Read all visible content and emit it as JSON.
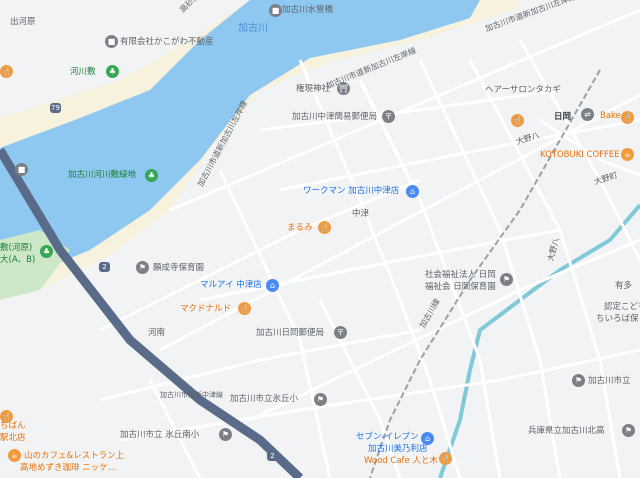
{
  "colors": {
    "background": "#f1f3f4",
    "water": "#8ec7ef",
    "sandbar": "#f7f2dd",
    "highway": "#5a6b89",
    "local_road": "#ffffff",
    "label_grey": "#5f6368",
    "label_food": "#e8710a",
    "label_shop": "#1a73e8",
    "label_park": "#188038",
    "label_water": "#4f8fd9"
  },
  "labels": {
    "dekawara": "出河原",
    "river_name": "加古川",
    "takasago_kishi": "高砂加古川",
    "suikan": "加古川水管橋",
    "kakogawa_realty": "有限会社かこがわ不動産",
    "kawajiki": "河川敷",
    "road_north_1": "加古川市道新加古川左岸線",
    "road_north_2": "加古川市道新加古川左岸線",
    "road_center": "加古川市道新加古川左岸線",
    "road_left": "加古川市道新加古川左岸線",
    "kakogawa_road_south": "加古川市道新加古川左岸線",
    "gongen": "権現神社",
    "nakatsu_post": "加古川中津簡易郵便局",
    "hair_salon": "ヘアーサロンタカギ",
    "station": "日岡",
    "bakery": "Bake",
    "kotobuki": "KOTOBUKI COFFEE",
    "onohachi": "大野八",
    "workman": "ワークマン 加古川中津店",
    "marumi": "まるみ",
    "nakatsu": "中津",
    "kawajiki_park": "加古川河川敷緑地",
    "kawajiki_rokushiki": "敷(河原)",
    "kawajiki_dai": "大(A、B)",
    "kumeji_hoiku": "願成寺保育園",
    "maruai": "マルアイ 中津店",
    "mcdonalds": "マクドナルド",
    "hiooka_post": "加古川日岡郵便局",
    "kawaminami": "河南",
    "hioka_station_road": "加古川線",
    "welfare_1": "社会福祉法人 日岡",
    "welfare_2": "福祉会 日岡保育園",
    "onohachi_2": "大野八",
    "arise": "有多",
    "nintei_1": "認定こども",
    "nintei_2": "ちいろば保",
    "kakogawa_nishi": "加古川市立",
    "hyogo_kita": "兵庫県立加古川北高",
    "hyogo_kita_short": "加古川市立 氷丘小",
    "hyogo_shougakko": "加古川市立氷丘小",
    "kakogawa_oka_road": "加古川市道新中津線",
    "hioka_naka": "加古川市立 氷丘南小",
    "seven": "セブン-イレブン",
    "seven_2": "加古川美乃利店",
    "wood_cafe": "Wood Cafe 人と木",
    "chiban": "ちばん",
    "chiban_2": "駅北店",
    "yamanoue_1": "山のカフェ&レストラン上",
    "yamanoue_2": "高地めずき珈琲 ニッケ…",
    "hiokamai": "大野町",
    "hiokamai_2": "大野町"
  },
  "route_shields": {
    "r1": "2",
    "r2": "2",
    "r3": "79"
  },
  "icons": {
    "pin_realty": "building-icon",
    "pin_suikan": "building-icon",
    "pin_gongen": "shrine-icon",
    "pin_post": "post-office-icon",
    "pin_food": "restaurant-icon",
    "pin_shop": "shopping-bag-icon",
    "pin_school": "school-icon",
    "pin_park": "tree-icon",
    "pin_train": "train-icon"
  }
}
